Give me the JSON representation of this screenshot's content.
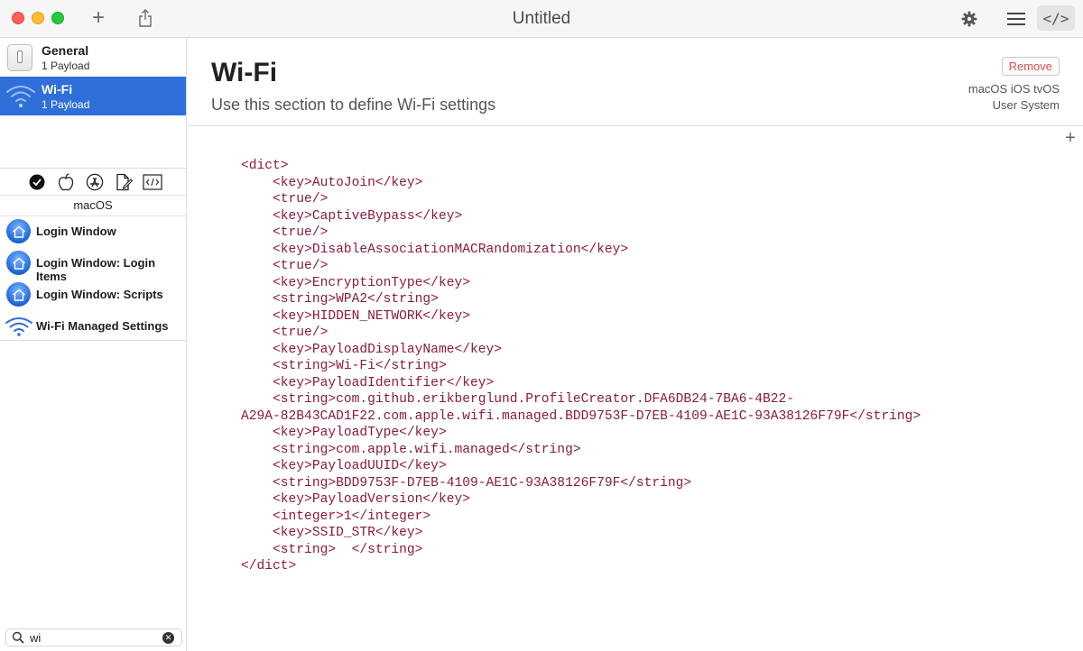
{
  "window": {
    "title": "Untitled",
    "add_icon": "plus-icon",
    "share_icon": "share-icon",
    "settings_icon": "gear-icon",
    "menu_icon": "list-icon",
    "code_view_label": "</>"
  },
  "sidebar": {
    "payloads": [
      {
        "name": "General",
        "count": "1 Payload",
        "icon": "switch-icon",
        "selected": false
      },
      {
        "name": "Wi-Fi",
        "count": "1 Payload",
        "icon": "wifi-icon",
        "selected": true
      }
    ],
    "filters": [
      {
        "icon": "checkmark-circle-icon"
      },
      {
        "icon": "apple-icon"
      },
      {
        "icon": "app-store-icon"
      },
      {
        "icon": "document-edit-icon"
      },
      {
        "icon": "code-icon"
      }
    ],
    "platform_label": "macOS",
    "library": [
      {
        "name": "Login Window",
        "icon": "home-icon"
      },
      {
        "name": "Login Window: Login Items",
        "icon": "home-icon"
      },
      {
        "name": "Login Window: Scripts",
        "icon": "home-icon"
      },
      {
        "name": "Wi-Fi Managed Settings",
        "icon": "wifi-icon"
      }
    ],
    "search": {
      "value": "wi",
      "placeholder": ""
    }
  },
  "main": {
    "title": "Wi-Fi",
    "description": "Use this section to define Wi-Fi settings",
    "remove_label": "Remove",
    "platforms": "macOS iOS tvOS",
    "scope": "User System",
    "add_label": "+",
    "code_lines": [
      "<dict>",
      "    <key>AutoJoin</key>",
      "    <true/>",
      "    <key>CaptiveBypass</key>",
      "    <true/>",
      "    <key>DisableAssociationMACRandomization</key>",
      "    <true/>",
      "    <key>EncryptionType</key>",
      "    <string>WPA2</string>",
      "    <key>HIDDEN_NETWORK</key>",
      "    <true/>",
      "    <key>PayloadDisplayName</key>",
      "    <string>Wi-Fi</string>",
      "    <key>PayloadIdentifier</key>",
      "    <string>com.github.erikberglund.ProfileCreator.DFA6DB24-7BA6-4B22-",
      "A29A-82B43CAD1F22.com.apple.wifi.managed.BDD9753F-D7EB-4109-AE1C-93A38126F79F</string>",
      "    <key>PayloadType</key>",
      "    <string>com.apple.wifi.managed</string>",
      "    <key>PayloadUUID</key>",
      "    <string>BDD9753F-D7EB-4109-AE1C-93A38126F79F</string>",
      "    <key>PayloadVersion</key>",
      "    <integer>1</integer>",
      "    <key>SSID_STR</key>",
      "    <string>  </string>",
      "</dict>"
    ]
  }
}
